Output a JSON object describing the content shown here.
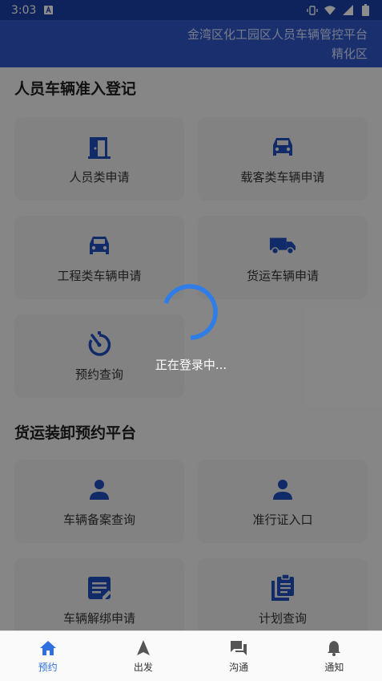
{
  "status_bar": {
    "time": "3:03",
    "icons": [
      "notification-a-icon",
      "vibrate-icon",
      "wifi-icon",
      "signal-icon",
      "battery-icon"
    ]
  },
  "header": {
    "title_line1": "金湾区化工园区人员车辆管控平台",
    "title_line2": "精化区"
  },
  "sections": {
    "entry": {
      "title": "人员车辆准入登记",
      "cards": [
        {
          "label": "人员类申请",
          "icon": "door-icon"
        },
        {
          "label": "载客类车辆申请",
          "icon": "car-icon"
        },
        {
          "label": "工程类车辆申请",
          "icon": "car-icon"
        },
        {
          "label": "货运车辆申请",
          "icon": "truck-icon"
        },
        {
          "label": "预约查询",
          "icon": "timer-icon"
        }
      ]
    },
    "freight": {
      "title": "货运装卸预约平台",
      "cards": [
        {
          "label": "车辆备案查询",
          "icon": "person-icon"
        },
        {
          "label": "准行证入口",
          "icon": "person-icon"
        },
        {
          "label": "车辆解绑申请",
          "icon": "edit-document-icon"
        },
        {
          "label": "计划查询",
          "icon": "clipboard-icon"
        }
      ]
    }
  },
  "loading": {
    "text": "正在登录中..."
  },
  "bottom_nav": {
    "items": [
      {
        "label": "预约",
        "icon": "home-icon",
        "active": true
      },
      {
        "label": "出发",
        "icon": "navigation-icon",
        "active": false
      },
      {
        "label": "沟通",
        "icon": "chat-icon",
        "active": false
      },
      {
        "label": "通知",
        "icon": "bell-icon",
        "active": false
      }
    ]
  },
  "colors": {
    "header_bg": "#2f56c8",
    "icon_blue": "#1f4fbf",
    "spinner": "#2f7de8",
    "nav_active": "#2f6fe0"
  }
}
